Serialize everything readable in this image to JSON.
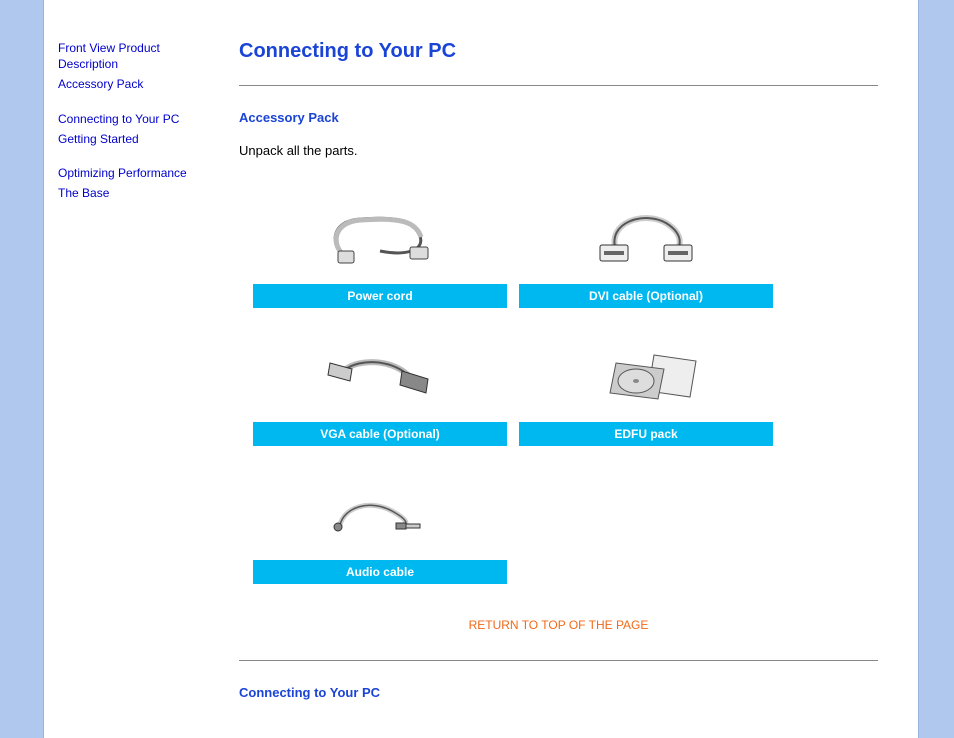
{
  "nav": {
    "items": [
      {
        "label": "Front View Product Description"
      },
      {
        "label": "Accessory Pack"
      },
      {
        "label": "Connecting to Your PC"
      },
      {
        "label": "Getting Started"
      },
      {
        "label": "Optimizing Performance"
      },
      {
        "label": "The Base"
      }
    ]
  },
  "page": {
    "title": "Connecting to Your PC"
  },
  "accessory": {
    "heading": "Accessory Pack",
    "intro": "Unpack all the parts.",
    "items": [
      {
        "label": "Power cord",
        "icon": "power-cord"
      },
      {
        "label": "DVI cable (Optional)",
        "icon": "dvi-cable"
      },
      {
        "label": "VGA cable (Optional)",
        "icon": "vga-cable"
      },
      {
        "label": "EDFU pack",
        "icon": "edfu-pack"
      },
      {
        "label": "Audio cable",
        "icon": "audio-cable"
      }
    ],
    "return_label": "RETURN TO TOP OF THE PAGE"
  },
  "connecting": {
    "heading": "Connecting to Your PC"
  }
}
